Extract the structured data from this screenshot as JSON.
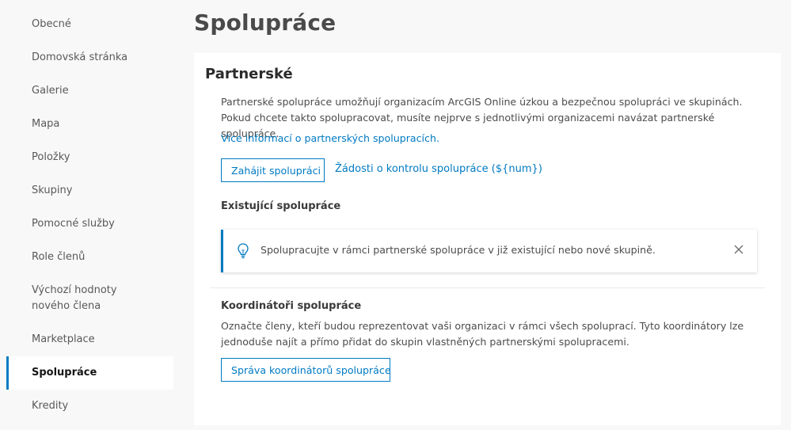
{
  "sidebar": {
    "items": [
      {
        "label": "Obecné"
      },
      {
        "label": "Domovská stránka"
      },
      {
        "label": "Galerie"
      },
      {
        "label": "Mapa"
      },
      {
        "label": "Položky"
      },
      {
        "label": "Skupiny"
      },
      {
        "label": "Pomocné služby"
      },
      {
        "label": "Role členů"
      },
      {
        "label": "Výchozí hodnoty nového člena"
      },
      {
        "label": "Marketplace"
      },
      {
        "label": "Spolupráce",
        "active": true
      },
      {
        "label": "Kredity"
      }
    ]
  },
  "page": {
    "title": "Spolupráce"
  },
  "partner": {
    "title": "Partnerské",
    "description": "Partnerské spolupráce umožňují organizacím ArcGIS Online úzkou a bezpečnou spolupráci ve skupinách. Pokud chcete takto spolupracovat, musíte nejprve s jednotlivými organizacemi navázat partnerské spolupráce.",
    "more_info_link": "Více informací o partnerských spolupracích.",
    "start_button": "Zahájit spolupráci",
    "review_link": "Žádosti o kontrolu spolupráce (${num})",
    "existing_title": "Existující spolupráce",
    "notice": {
      "icon": "lightbulb-icon",
      "text": "Spolupracujte v rámci partnerské spolupráce v již existující nebo nové skupině."
    },
    "coordinators_title": "Koordinátoři spolupráce",
    "coordinators_description": "Označte členy, kteří budou reprezentovat vaši organizaci v rámci všech spoluprací. Tyto koordinátory lze jednoduše najít a přímo přidat do skupin vlastněných partnerskými spolupracemi.",
    "manage_button": "Správa koordinátorů spolupráce"
  },
  "colors": {
    "accent": "#007ac2",
    "background": "#f8f8f8",
    "panel": "#ffffff"
  }
}
